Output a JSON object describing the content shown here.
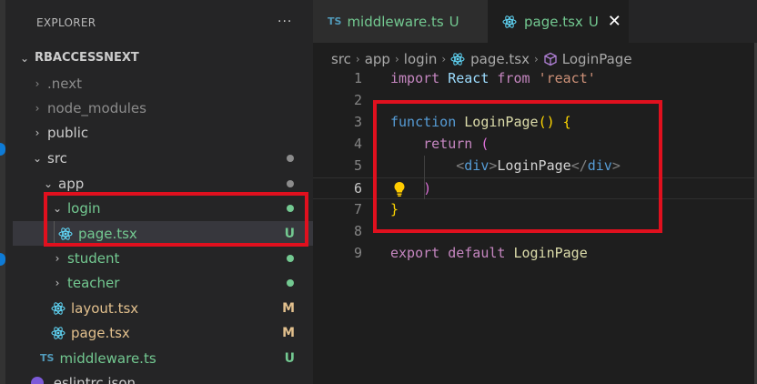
{
  "sidebar": {
    "title": "EXPLORER",
    "more": "···",
    "root": "RBACCESSNEXT",
    "items": [
      {
        "label": ".next",
        "chevron": "›",
        "badge": ""
      },
      {
        "label": "node_modules",
        "chevron": "›",
        "badge": ""
      },
      {
        "label": "public",
        "chevron": "›",
        "badge": ""
      },
      {
        "label": "src",
        "chevron": "⌄",
        "badge": "dot"
      },
      {
        "label": "app",
        "chevron": "⌄",
        "badge": "dot"
      },
      {
        "label": "login",
        "chevron": "⌄",
        "badge": "dot"
      },
      {
        "label": "page.tsx",
        "badge": "U"
      },
      {
        "label": "student",
        "chevron": "›",
        "badge": "dot"
      },
      {
        "label": "teacher",
        "chevron": "›",
        "badge": "dot"
      },
      {
        "label": "layout.tsx",
        "badge": "M"
      },
      {
        "label": "page.tsx",
        "badge": "M"
      },
      {
        "label": "middleware.ts",
        "icon_text": "TS",
        "badge": "U"
      },
      {
        "label": ".eslintrc.json",
        "badge": ""
      }
    ]
  },
  "tabs": [
    {
      "icon_text": "TS",
      "label": "middleware.ts",
      "state": "U"
    },
    {
      "label": "page.tsx",
      "state": "U",
      "close": "✕"
    }
  ],
  "breadcrumb": [
    "src",
    "app",
    "login",
    "page.tsx",
    "LoginPage"
  ],
  "breadcrumb_sep": "›",
  "editor": {
    "line_numbers": [
      "1",
      "2",
      "3",
      "4",
      "5",
      "6",
      "7",
      "8",
      "9"
    ],
    "l1": {
      "import": "import",
      "react": "React",
      "from": "from",
      "str": "'react'"
    },
    "l3": {
      "function": "function",
      "name": "LoginPage",
      "parens": "()",
      "brace": "{"
    },
    "l4": {
      "return": "return",
      "paren": "("
    },
    "l5": {
      "open": "<",
      "tag": "div",
      "close": ">",
      "text": "LoginPage",
      "end_open": "</",
      "end_tag": "div",
      "end_close": ">"
    },
    "l6": {
      "paren": ")"
    },
    "l7": {
      "brace": "}"
    },
    "l9": {
      "export": "export",
      "default": "default",
      "name": "LoginPage"
    }
  },
  "colors": {
    "accent_red": "#e0101e",
    "untracked_green": "#73c991",
    "modified_yellow": "#e2c08d"
  }
}
